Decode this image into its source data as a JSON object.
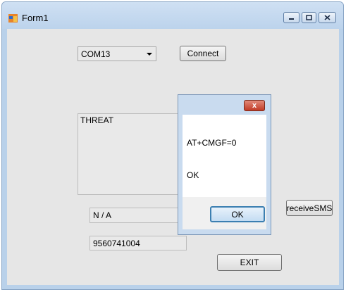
{
  "window": {
    "title": "Form1"
  },
  "combo": {
    "value": "COM13"
  },
  "buttons": {
    "connect": "Connect",
    "receive_sms": "receiveSMS",
    "exit": "EXIT"
  },
  "message_area": {
    "text": "THREAT"
  },
  "fields": {
    "status": "N / A",
    "phone": "9560741004"
  },
  "dialog": {
    "line1": "AT+CMGF=0",
    "line2": "OK",
    "ok": "OK",
    "close": "x"
  },
  "icons": {
    "app": "form-icon",
    "minimize": "minimize-icon",
    "maximize": "maximize-icon",
    "close": "close-icon"
  },
  "colors": {
    "window_frame": "#b9d1ea",
    "client": "#e6e6e6",
    "dialog_close": "#c13b26"
  }
}
